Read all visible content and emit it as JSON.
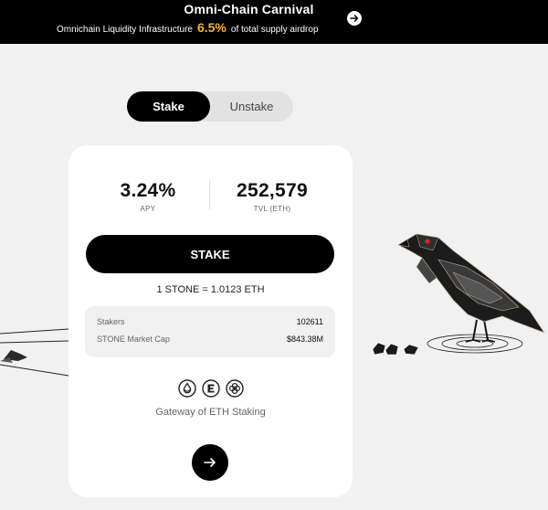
{
  "banner": {
    "title": "Omni-Chain Carnival",
    "subtitle_prefix": "Omnichain Liquidity Infrastructure",
    "highlight": "6.5%",
    "subtitle_suffix": "of total supply airdrop",
    "highlight_color": "#f2b531"
  },
  "toggle": {
    "stake_label": "Stake",
    "unstake_label": "Unstake",
    "active": "Stake"
  },
  "stats": {
    "apy_value": "3.24%",
    "apy_label": "APY",
    "tvl_value": "252,579",
    "tvl_label": "TVL (ETH)"
  },
  "action": {
    "stake_button_label": "STAKE",
    "exchange_rate": "1 STONE = 1.0123 ETH"
  },
  "info": {
    "stakers_label": "Stakers",
    "stakers_value": "102611",
    "market_cap_label": "STONE Market Cap",
    "market_cap_value": "$843.38M"
  },
  "partners": {
    "icons": [
      "lido-drop-icon",
      "eigenlayer-logo-icon",
      "symbiotic-knot-icon"
    ]
  },
  "gateway_text": "Gateway of ETH Staking",
  "colors": {
    "background": "#f1f1f1",
    "banner": "#000000",
    "card": "#ffffff",
    "primary_button": "#000000",
    "accent": "#f2b531",
    "raven_eye": "#e0202a"
  }
}
